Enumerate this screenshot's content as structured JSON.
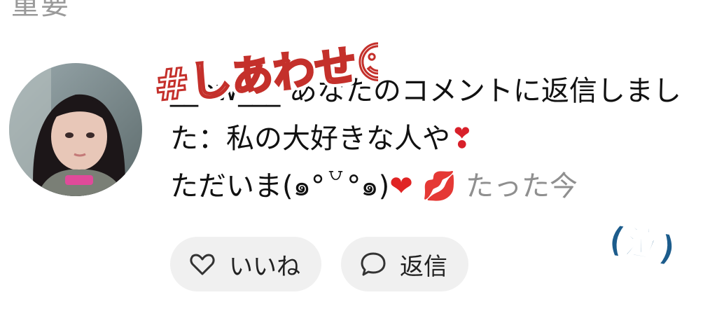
{
  "header": {
    "cut_text": "重要"
  },
  "comment": {
    "username": "__ow___",
    "message_prefix": " あなたのコメントに返信しました：私の大好きな人や",
    "emoji_exclamation": "❣",
    "message_suffix": "ただいま(๑°꒵°๑)",
    "emoji_heart": "❤",
    "emoji_lips": "💋",
    "timestamp": "たった今"
  },
  "actions": {
    "like_label": "いいね",
    "reply_label": "返信"
  },
  "stickers": {
    "hashtag": "#しあわせ☺",
    "cry": "(泣)"
  },
  "colors": {
    "text": "#111111",
    "muted": "#8f8f8f",
    "pill_bg": "#f0f0f0",
    "sticker_red": "#c4302b",
    "sticker_blue": "#1c5c8c"
  },
  "icons": {
    "like": "heart-outline-icon",
    "reply": "speech-bubble-icon"
  }
}
